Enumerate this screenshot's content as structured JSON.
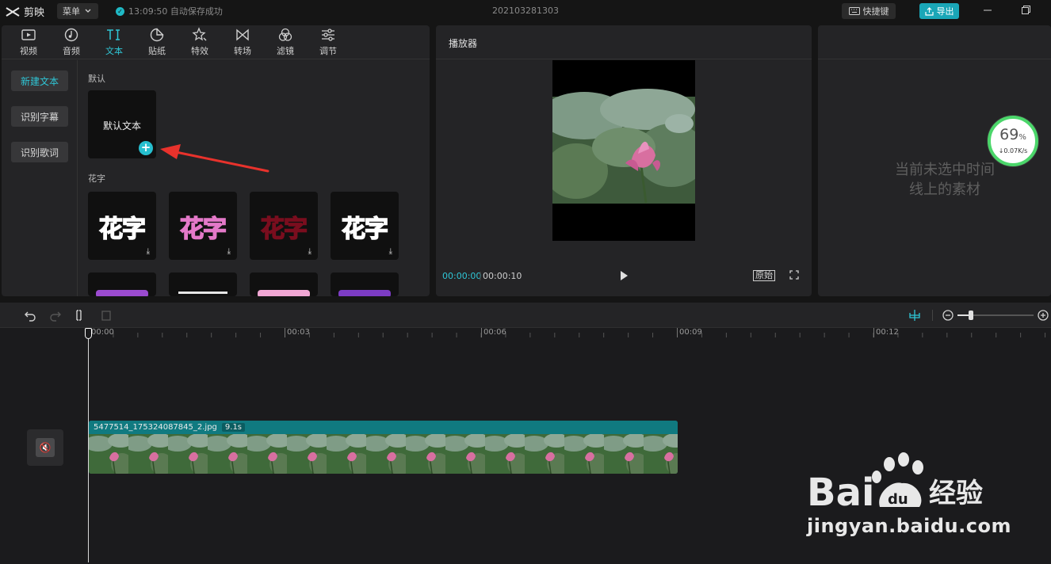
{
  "app": {
    "name": "剪映",
    "menu_label": "菜单",
    "save_status": "13:09:50 自动保存成功",
    "document_title": "202103281303",
    "shortcut_label": "快捷键",
    "export_label": "导出"
  },
  "media_toolbar": {
    "tabs": [
      {
        "label": "视频",
        "icon": "video-icon"
      },
      {
        "label": "音频",
        "icon": "audio-icon"
      },
      {
        "label": "文本",
        "icon": "text-icon",
        "active": true
      },
      {
        "label": "贴纸",
        "icon": "sticker-icon"
      },
      {
        "label": "特效",
        "icon": "effect-icon"
      },
      {
        "label": "转场",
        "icon": "transition-icon"
      },
      {
        "label": "滤镜",
        "icon": "filter-icon"
      },
      {
        "label": "调节",
        "icon": "adjust-icon"
      }
    ]
  },
  "text_sidebar": {
    "items": [
      {
        "label": "新建文本",
        "active": true
      },
      {
        "label": "识别字幕"
      },
      {
        "label": "识别歌词"
      }
    ]
  },
  "text_library": {
    "default_section": "默认",
    "default_card_label": "默认文本",
    "fancy_section": "花字",
    "fancy_cards": [
      {
        "text": "花字",
        "color": "#f58ab8",
        "stroke": "#ffffff"
      },
      {
        "text": "花字",
        "color": "#ffffff",
        "stroke": "#e479c9"
      },
      {
        "text": "花字",
        "color": "#d9213c",
        "stroke": "#7a0d1e"
      },
      {
        "text": "花字",
        "color": "#f07aa8",
        "stroke": "#ffffff"
      }
    ]
  },
  "player": {
    "title": "播放器",
    "current_time": "00:00:00",
    "total_time": "00:00:10",
    "original_label": "原始"
  },
  "properties": {
    "empty_message_line1": "当前未选中时间",
    "empty_message_line2": "线上的素材"
  },
  "network_widget": {
    "percent": "69",
    "percent_sign": "%",
    "rate": "↓0.07K/s"
  },
  "timeline": {
    "ruler_ticks": [
      "00:00",
      "00:03",
      "00:06",
      "00:09",
      "00:12"
    ],
    "clip_name": "5477514_175324087845_2.jpg",
    "clip_duration": "9.1s"
  },
  "watermark": {
    "url": "jingyan.baidu.com",
    "brand_text": "Bai",
    "brand_suffix": "经验"
  },
  "colors": {
    "accent": "#2fc6d6",
    "export": "#1aa6b7",
    "clip": "#0f7a80"
  }
}
